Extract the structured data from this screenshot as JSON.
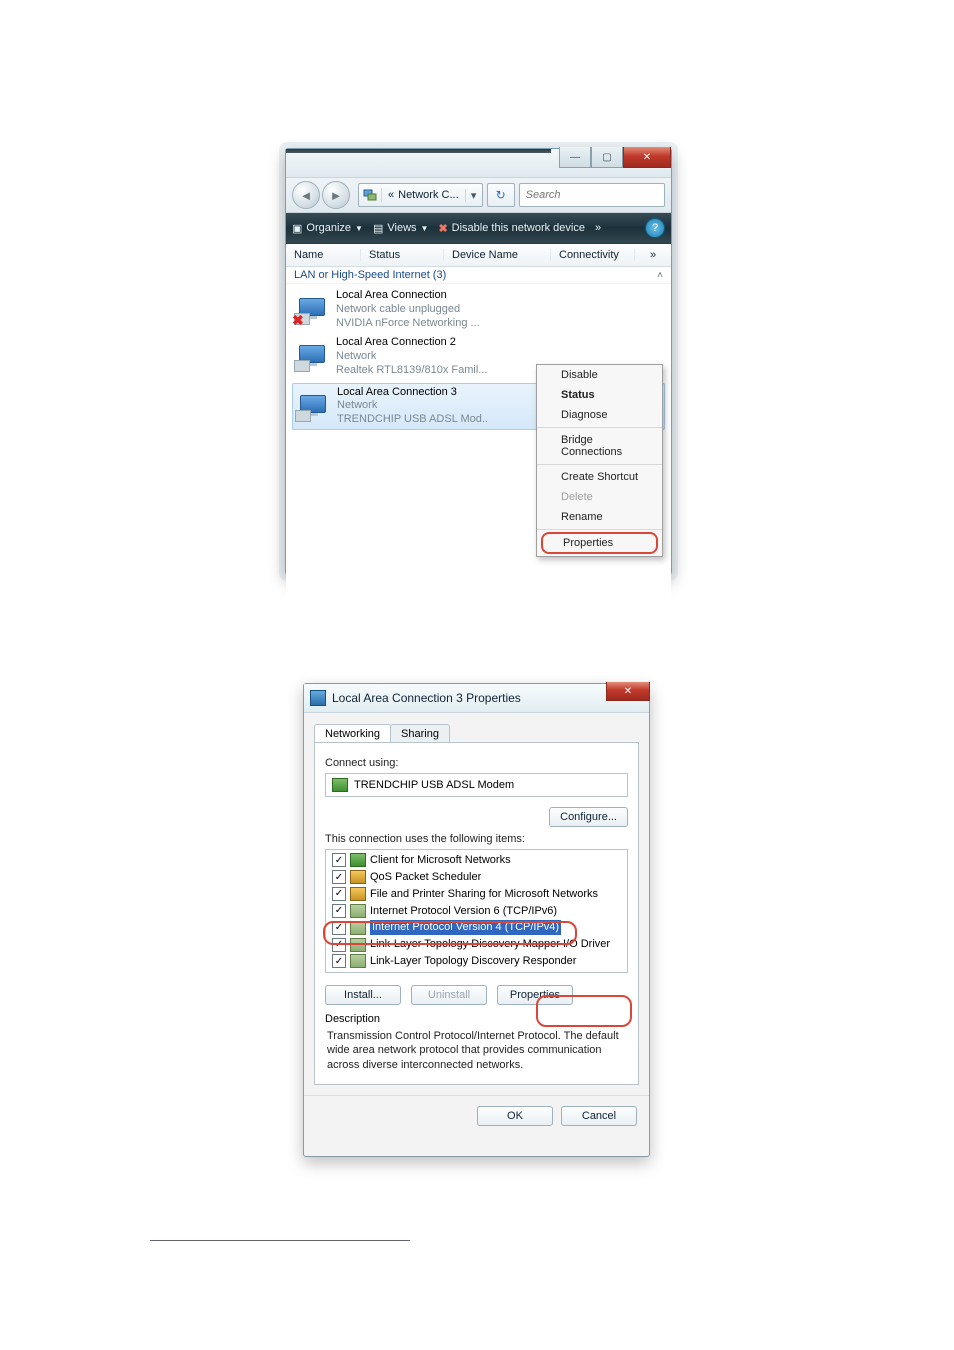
{
  "win1": {
    "breadcrumb_prefix": "«",
    "breadcrumb_label": "Network C...",
    "search_placeholder": "Search",
    "toolbar": {
      "organize": "Organize",
      "views": "Views",
      "disable": "Disable this network device",
      "chevr": "»"
    },
    "columns": {
      "name": "Name",
      "status": "Status",
      "device": "Device Name",
      "connectivity": "Connectivity",
      "more": "»"
    },
    "group_label": "LAN or High-Speed Internet (3)",
    "items": [
      {
        "title": "Local Area Connection",
        "line2": "Network cable unplugged",
        "line3": "NVIDIA nForce Networking ...",
        "unplugged": true
      },
      {
        "title": "Local Area Connection 2",
        "line2": "Network",
        "line3": "Realtek RTL8139/810x Famil...",
        "unplugged": false
      },
      {
        "title": "Local Area Connection 3",
        "line2": "Network",
        "line3": "TRENDCHIP USB ADSL Mod..",
        "unplugged": false
      }
    ],
    "context_menu": {
      "disable": "Disable",
      "status": "Status",
      "diagnose": "Diagnose",
      "bridge": "Bridge Connections",
      "shortcut": "Create Shortcut",
      "delete": "Delete",
      "rename": "Rename",
      "properties": "Properties"
    }
  },
  "win2": {
    "title": "Local Area Connection 3 Properties",
    "tabs": {
      "networking": "Networking",
      "sharing": "Sharing"
    },
    "connect_using": "Connect using:",
    "adapter": "TRENDCHIP USB ADSL Modem",
    "configure": "Configure...",
    "items_label": "This connection uses the following items:",
    "items": [
      "Client for Microsoft Networks",
      "QoS Packet Scheduler",
      "File and Printer Sharing for Microsoft Networks",
      "Internet Protocol Version 6 (TCP/IPv6)",
      "Internet Protocol Version 4 (TCP/IPv4)",
      "Link-Layer Topology Discovery Mapper I/O Driver",
      "Link-Layer Topology Discovery Responder"
    ],
    "install": "Install...",
    "uninstall": "Uninstall",
    "properties": "Properties",
    "desc_title": "Description",
    "desc_text": "Transmission Control Protocol/Internet Protocol. The default wide area network protocol that provides communication across diverse interconnected networks.",
    "ok": "OK",
    "cancel": "Cancel"
  }
}
